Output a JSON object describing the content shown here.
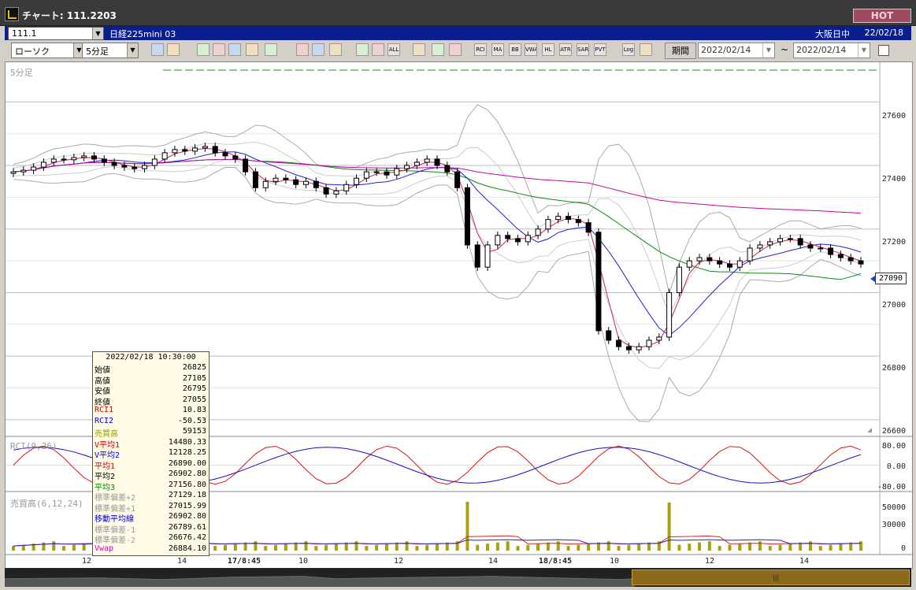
{
  "window": {
    "title": "チャート: 111.2203",
    "hot_label": "HOT"
  },
  "symbol_bar": {
    "code": "111.1",
    "name": "日経225mini 03",
    "market": "大阪日中",
    "date": "22/02/18"
  },
  "toolbar": {
    "chart_type": "ローソク",
    "interval": "5分足",
    "period_label": "期間",
    "date_from": "2022/02/14",
    "date_to": "2022/02/14",
    "tilde": "~",
    "buttons": [
      "zoom",
      "crosshair",
      "download",
      "chart-add",
      "chart-bars",
      "draw-lines",
      "info",
      "pen",
      "cursor",
      "undo",
      "candle-a",
      "candle-b",
      "ALL",
      "wrench-a",
      "wrench-b",
      "palette",
      "RCI",
      "MA",
      "BB",
      "VWA",
      "HL",
      "ATR",
      "PSAR",
      "PVT",
      "Log",
      "exit"
    ]
  },
  "panels": {
    "price_label": "5分足",
    "rci_label": "RCI(9,26)",
    "volume_label": "売買高(6,12,24)",
    "last_price": "27090"
  },
  "axes": {
    "price_ticks": [
      "27600",
      "27400",
      "27200",
      "27000",
      "26800",
      "26600"
    ],
    "rci_ticks": [
      "80.00",
      "0.00",
      "-80.00"
    ],
    "volume_ticks": [
      "50000",
      "30000",
      "0"
    ],
    "x_ticks": [
      {
        "label": "12",
        "bold": false
      },
      {
        "label": "14",
        "bold": false
      },
      {
        "label": "17/8:45",
        "bold": true
      },
      {
        "label": "10",
        "bold": false
      },
      {
        "label": "12",
        "bold": false
      },
      {
        "label": "14",
        "bold": false
      },
      {
        "label": "18/8:45",
        "bold": true
      },
      {
        "label": "10",
        "bold": false
      },
      {
        "label": "12",
        "bold": false
      },
      {
        "label": "14",
        "bold": false
      }
    ]
  },
  "info_panel": {
    "datetime": "2022/02/18  10:30:00",
    "rows": [
      {
        "k": "始値",
        "v": "26825",
        "c": "#000000"
      },
      {
        "k": "高値",
        "v": "27105",
        "c": "#000000"
      },
      {
        "k": "安値",
        "v": "26795",
        "c": "#000000"
      },
      {
        "k": "終値",
        "v": "27055",
        "c": "#000000"
      },
      {
        "k": "RCI1",
        "v": "10.83",
        "c": "#cc0000"
      },
      {
        "k": "RCI2",
        "v": "-50.53",
        "c": "#0000cc"
      },
      {
        "k": "売買高",
        "v": "59153",
        "c": "#999900"
      },
      {
        "k": "V平均1",
        "v": "14480.33",
        "c": "#cc0000"
      },
      {
        "k": "V平均2",
        "v": "12128.25",
        "c": "#0000cc"
      },
      {
        "k": "平均1",
        "v": "26890.00",
        "c": "#cc0000"
      },
      {
        "k": "平均2",
        "v": "26902.80",
        "c": "#000000"
      },
      {
        "k": "平均3",
        "v": "27156.80",
        "c": "#008800"
      },
      {
        "k": "標準偏差+2",
        "v": "27129.18",
        "c": "#999999"
      },
      {
        "k": "標準偏差+1",
        "v": "27015.99",
        "c": "#999999"
      },
      {
        "k": "移動平均線",
        "v": "26902.80",
        "c": "#0000cc"
      },
      {
        "k": "標準偏差-1",
        "v": "26789.61",
        "c": "#999999"
      },
      {
        "k": "標準偏差-2",
        "v": "26676.42",
        "c": "#999999"
      },
      {
        "k": "Vwap",
        "v": "26884.10",
        "c": "#cc00cc"
      }
    ]
  },
  "chart_data": {
    "type": "candlestick",
    "y_range": [
      26560,
      27700
    ],
    "dashed_level": 27700,
    "close_series": [
      27380,
      27385,
      27395,
      27410,
      27420,
      27418,
      27425,
      27430,
      27420,
      27410,
      27400,
      27395,
      27390,
      27400,
      27420,
      27440,
      27450,
      27445,
      27455,
      27460,
      27440,
      27430,
      27420,
      27380,
      27330,
      27350,
      27360,
      27355,
      27340,
      27350,
      27330,
      27310,
      27320,
      27340,
      27360,
      27380,
      27380,
      27370,
      27390,
      27400,
      27410,
      27420,
      27400,
      27380,
      27330,
      27150,
      27080,
      27150,
      27180,
      27170,
      27160,
      27180,
      27200,
      27230,
      27240,
      27230,
      27220,
      27190,
      26880,
      26850,
      26830,
      26820,
      26830,
      26850,
      26860,
      27000,
      27080,
      27100,
      27110,
      27100,
      27090,
      27080,
      27100,
      27140,
      27150,
      27160,
      27170,
      27170,
      27150,
      27140,
      27140,
      27120,
      27110,
      27100,
      27090
    ],
    "volume_spikes": [
      {
        "x_index": 45,
        "value": 63000
      },
      {
        "x_index": 65,
        "value": 62000
      }
    ],
    "rci_range": [
      -100,
      100
    ],
    "volume_max": 65000
  }
}
